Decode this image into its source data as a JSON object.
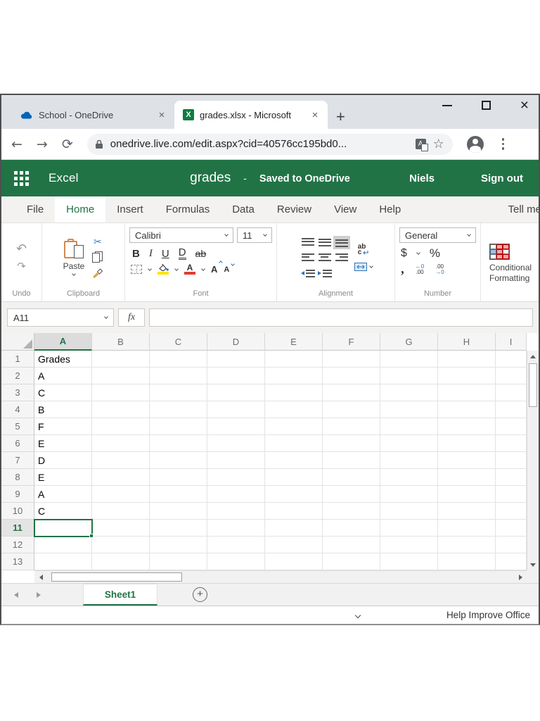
{
  "browser": {
    "tab1": {
      "title": "School - OneDrive"
    },
    "tab2": {
      "title": "grades.xlsx - Microsoft"
    },
    "tab_close": "×",
    "new_tab": "+",
    "window_close": "×",
    "url": "onedrive.live.com/edit.aspx?cid=40576cc195bd0..."
  },
  "header": {
    "app": "Excel",
    "file": "grades",
    "dash": "-",
    "status": "Saved to OneDrive",
    "user": "Niels",
    "signout": "Sign out"
  },
  "menu": {
    "items": [
      "File",
      "Home",
      "Insert",
      "Formulas",
      "Data",
      "Review",
      "View",
      "Help"
    ],
    "active_index": 1,
    "tell_me": "Tell me"
  },
  "ribbon": {
    "undo_label": "Undo",
    "clipboard_label": "Clipboard",
    "font_label": "Font",
    "alignment_label": "Alignment",
    "number_label": "Number",
    "undo_glyph": "↶",
    "redo_glyph": "↷",
    "paste": "Paste",
    "cut_glyph": "✂",
    "font_name": "Calibri",
    "font_size": "11",
    "bold": "B",
    "italic": "I",
    "underline": "U",
    "double_underline": "D",
    "strikethrough": "ab",
    "font_color_letter": "A",
    "grow_font": "A",
    "shrink_font": "A",
    "fill_color_hex": "#ffe400",
    "font_color_hex": "#e03c31",
    "wrap_top": "ab",
    "wrap_bottom": "c",
    "number_format": "General",
    "currency": "$",
    "percent": "%",
    "comma": ",",
    "inc_dec_top": "←0",
    "inc_dec_bottom": ".00",
    "dec_dec_top": ".00",
    "dec_dec_bottom": "→0",
    "cond_format_line1": "Conditional",
    "cond_format_line2": "Formatting"
  },
  "formula_bar": {
    "name_box": "A11",
    "fx": "fx",
    "formula": ""
  },
  "grid": {
    "columns": [
      "A",
      "B",
      "C",
      "D",
      "E",
      "F",
      "G",
      "H",
      "I"
    ],
    "selected_column": "A",
    "selected_row": 11,
    "row_count": 13,
    "values": {
      "1": "Grades",
      "2": "A",
      "3": "C",
      "4": "B",
      "5": "F",
      "6": "E",
      "7": "D",
      "8": "E",
      "9": "A",
      "10": "C"
    }
  },
  "sheet_bar": {
    "sheet": "Sheet1",
    "add": "+"
  },
  "status_bar": {
    "help": "Help Improve Office"
  },
  "colors": {
    "excel_green": "#217346",
    "chrome_tabstrip": "#dee1e6",
    "selection_border": "#217346",
    "onedrive_blue": "#0364b8",
    "excel_icon_green": "#107c41"
  }
}
